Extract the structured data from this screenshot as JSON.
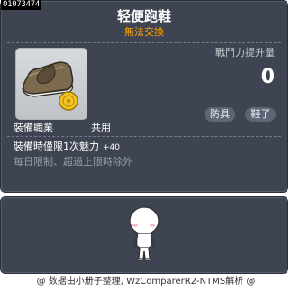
{
  "item": {
    "id": "01073474",
    "name": "轻便跑鞋",
    "trade_status": "無法交換",
    "power_label": "戰鬥力提升量",
    "power_value": "0",
    "category": "防具",
    "subtype": "鞋子",
    "job_label": "裝備職業",
    "job_value": "共用",
    "effect_text": "裝備時僅限1次魅力",
    "effect_amount": "+40",
    "limit_note": "每日限制、超過上限時除外"
  },
  "icons": {
    "item_icon": "shoe-icon",
    "coin": "coin-icon",
    "preview": "avatar-figure"
  },
  "colors": {
    "panel_bg": "#3e4451",
    "title": "#ffffff",
    "trade_status": "#ffa500",
    "note": "#979ca7"
  },
  "footer": {
    "credit": "@ 数据由小册子整理, WzComparerR2-NTMS解析 @"
  }
}
